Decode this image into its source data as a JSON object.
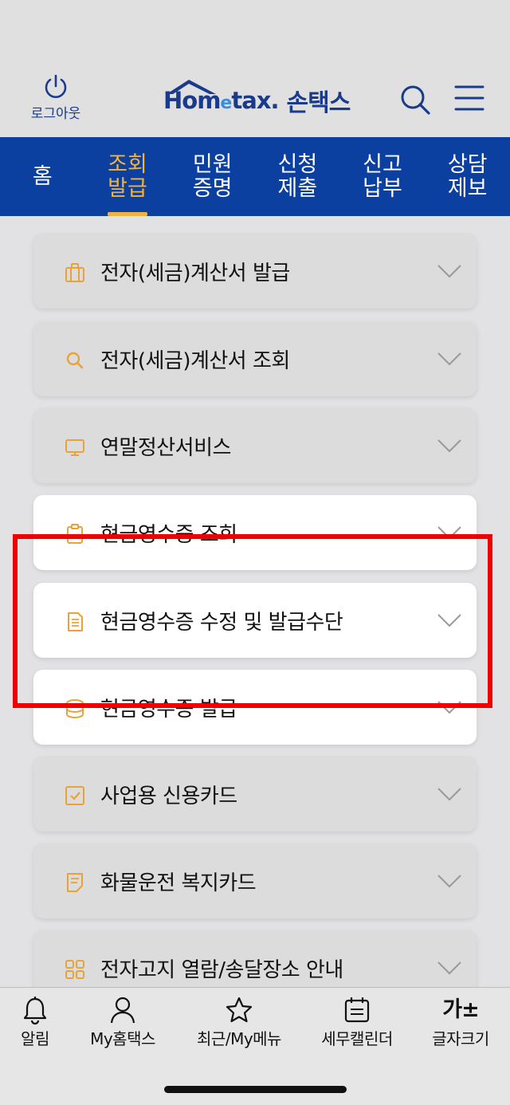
{
  "header": {
    "logout_label": "로그아웃",
    "logo_brand_a": "Hom",
    "logo_brand_e": "e",
    "logo_brand_b": "tax.",
    "logo_kor": "손택스"
  },
  "nav": [
    {
      "line1": "홈",
      "line2": "",
      "active": false
    },
    {
      "line1": "조회",
      "line2": "발급",
      "active": true
    },
    {
      "line1": "민원",
      "line2": "증명",
      "active": false
    },
    {
      "line1": "신청",
      "line2": "제출",
      "active": false
    },
    {
      "line1": "신고",
      "line2": "납부",
      "active": false
    },
    {
      "line1": "상담",
      "line2": "제보",
      "active": false
    }
  ],
  "menu": [
    {
      "label": "전자(세금)계산서 발급",
      "icon": "briefcase-icon"
    },
    {
      "label": "전자(세금)계산서 조회",
      "icon": "search-icon"
    },
    {
      "label": "연말정산서비스",
      "icon": "monitor-icon"
    },
    {
      "label": "현금영수증 조회",
      "icon": "clipboard-icon"
    },
    {
      "label": "현금영수증 수정 및 발급수단",
      "icon": "document-icon"
    },
    {
      "label": "현금영수증 발급",
      "icon": "database-icon"
    },
    {
      "label": "사업용 신용카드",
      "icon": "checkbox-icon"
    },
    {
      "label": "화물운전 복지카드",
      "icon": "note-icon"
    },
    {
      "label": "전자고지 열람/송달장소 안내",
      "icon": "grid-icon"
    }
  ],
  "tabbar": [
    {
      "label": "알림",
      "icon": "bell-icon"
    },
    {
      "label": "My홈택스",
      "icon": "person-icon"
    },
    {
      "label": "최근/My메뉴",
      "icon": "star-icon"
    },
    {
      "label": "세무캘린더",
      "icon": "calendar-icon"
    },
    {
      "label": "글자크기",
      "icon": "font-size-icon",
      "glyph": "가±"
    }
  ],
  "colors": {
    "nav_bg": "#0b3fa0",
    "accent": "#f2b33d",
    "brand": "#1a3a8c",
    "highlight": "#ee0000"
  }
}
